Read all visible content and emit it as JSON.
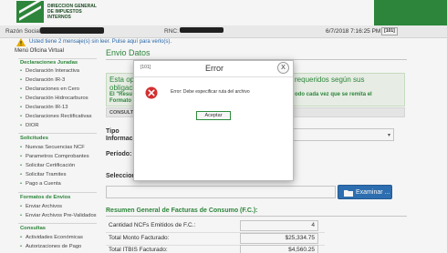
{
  "header": {
    "logo_lines": [
      "DIRECCION GENERAL",
      "DE IMPUESTOS",
      "INTERNOS"
    ]
  },
  "infobar": {
    "razon_social_label": "Razón Social:",
    "rnc_label": "RNC:",
    "datetime": "6/7/2018 7:16:25 PM",
    "logout_label": "[101]"
  },
  "messages": {
    "text": "Usted tiene 2 mensaje(s) sin leer. Pulse aquí para verlo(s).",
    "menu_title": "Menú Oficina Virtual"
  },
  "sidebar": {
    "sections": [
      {
        "title": "Declaraciones Juradas",
        "items": [
          "Declaración Interactiva",
          "Declaración IR-3",
          "Declaraciones en Cero",
          "Declaración Hidrocarburos",
          "Declaración IR-13",
          "Declaraciones Rectificativas",
          "DIOR"
        ]
      },
      {
        "title": "Solicitudes",
        "items": [
          "Nuevas Secuencias NCF",
          "Parametros Comprobantes",
          "Solicitar Certificación",
          "Solicitar Tramites",
          "Pago a Cuenta"
        ]
      },
      {
        "title": "Formatos de Envios",
        "items": [
          "Enviar Archivos",
          "Enviar Archivos Pre-Validados"
        ]
      },
      {
        "title": "Consultas",
        "items": [
          "Actividades Económicas",
          "Autorizaciones de Pago"
        ]
      }
    ]
  },
  "main": {
    "title": "Envio Datos",
    "notice": {
      "line1": "Esta op",
      "line2": "obligaci",
      "line3": "El \"Resu",
      "line4": "Formato",
      "right1": "requeridos según sus",
      "right2": "",
      "right3": "odo cada vez que se remita el"
    },
    "consult_label": "CONSULT",
    "tipo_label_1": "Tipo",
    "tipo_label_2": "Informac",
    "tipo_arrow": "▾",
    "periodo_label": "Período:",
    "seleccion_label": "Selecciona",
    "examinar_label": "Examinar ...",
    "resumen_title": "Resumen General de Facturas de Consumo (F.C.):",
    "rows": [
      {
        "label": "Cantidad NCFs Emitidos de F.C.:",
        "value": "4"
      },
      {
        "label": "Total Monto Facturado:",
        "value": "$25,334.75"
      },
      {
        "label": "Total ITBIS Facturado:",
        "value": "$4,560.25"
      }
    ]
  },
  "modal": {
    "id": "[101]",
    "title": "Error",
    "close_symbol": "X",
    "message": "Error: Debe especificar ruta del archivo",
    "accept_label": "Aceptar"
  },
  "colors": {
    "brand_green": "#2e8b3d",
    "link_blue": "#2b6cb0",
    "button_blue": "#2f73b8",
    "error_red": "#d32f2f"
  },
  "icons": [
    "warning-icon",
    "error-icon",
    "folder-icon",
    "close-icon",
    "chevron-down-icon",
    "logo-icon"
  ]
}
